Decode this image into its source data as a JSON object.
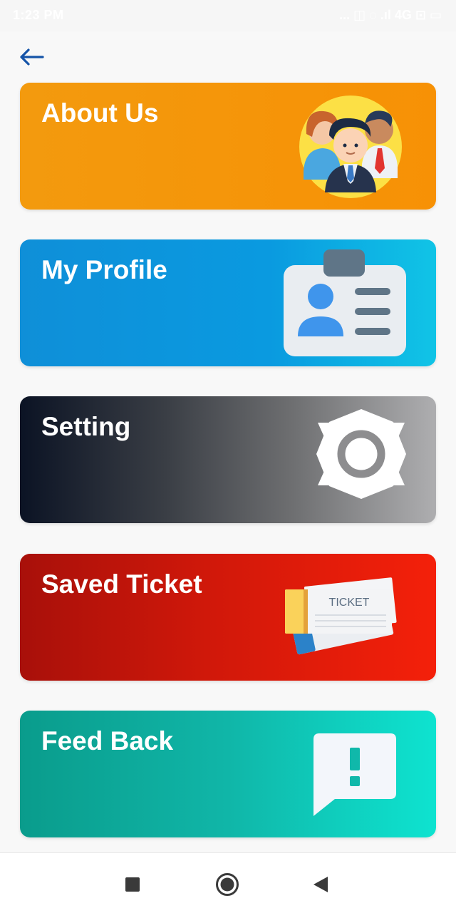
{
  "status_bar": {
    "time": "1:23 PM",
    "indicators": "... ◫ ◌ .ıl 4G ⊡ ▭"
  },
  "header": {
    "back_icon": "arrow-left-icon"
  },
  "menu": [
    {
      "id": "about",
      "label": "About Us",
      "icon": "team-people-icon",
      "color": "#f39a0e"
    },
    {
      "id": "profile",
      "label": "My Profile",
      "icon": "id-card-icon",
      "color": "#0f8fd8"
    },
    {
      "id": "setting",
      "label": "Setting",
      "icon": "gear-icon",
      "color": "#3a3e45"
    },
    {
      "id": "ticket",
      "label": "Saved Ticket",
      "icon": "ticket-icon",
      "color": "#d0180a",
      "art_text": "TICKET"
    },
    {
      "id": "feedback",
      "label": "Feed Back",
      "icon": "feedback-chat-icon",
      "color": "#10b6a8"
    }
  ],
  "nav_bar": {
    "recent_icon": "square-recents-icon",
    "home_icon": "circle-home-icon",
    "back_icon": "triangle-back-icon"
  }
}
